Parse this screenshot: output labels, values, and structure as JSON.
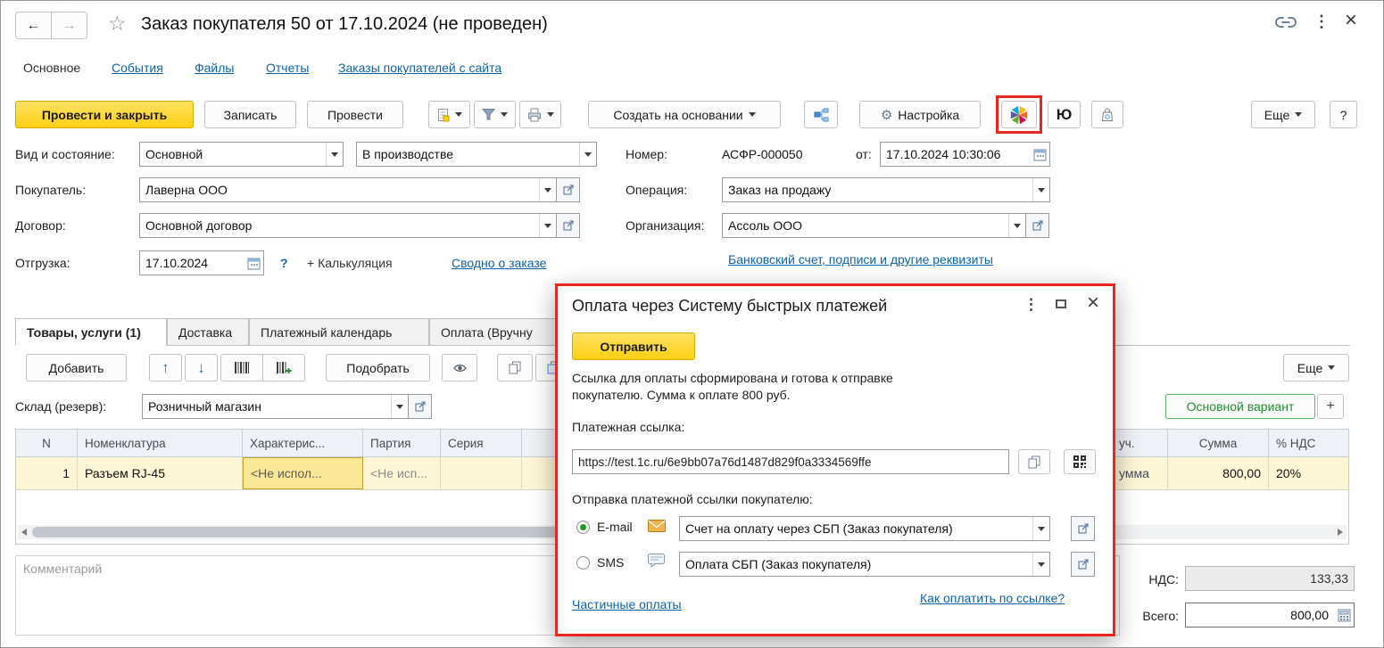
{
  "icons": {
    "back": "←",
    "forward": "→",
    "star": "☆",
    "kebab": "⋮",
    "close": "×",
    "gear": "⚙",
    "up": "↑",
    "down": "↓",
    "plus": "+"
  },
  "window": {
    "title": "Заказ покупателя 50 от 17.10.2024 (не проведен)"
  },
  "nav": {
    "main": "Основное",
    "events": "События",
    "files": "Файлы",
    "reports": "Отчеты",
    "site_orders": "Заказы покупателей с сайта"
  },
  "toolbar": {
    "post_and_close": "Провести и закрыть",
    "write": "Записать",
    "post": "Провести",
    "create_on_basis": "Создать на основании",
    "settings": "Настройка",
    "yookassa": "Ю",
    "more": "Еще",
    "help": "?"
  },
  "form": {
    "kind_state_label": "Вид и состояние:",
    "kind_value": "Основной",
    "state_value": "В производстве",
    "number_label": "Номер:",
    "number_value": "АСФР-000050",
    "from_label": "от:",
    "datetime_value": "17.10.2024 10:30:06",
    "buyer_label": "Покупатель:",
    "buyer_value": "Лаверна ООО",
    "operation_label": "Операция:",
    "operation_value": "Заказ на продажу",
    "contract_label": "Договор:",
    "contract_value": "Основной договор",
    "org_label": "Организация:",
    "org_value": "Ассоль ООО",
    "shipment_label": "Отгрузка:",
    "shipment_value": "17.10.2024",
    "shipment_help": "?",
    "calculation_label": "+ Калькуляция",
    "order_summary_link": "Сводно о заказе",
    "bank_details_link": "Банковский счет, подписи и другие реквизиты"
  },
  "doc_tabs": {
    "goods": "Товары, услуги (1)",
    "delivery": "Доставка",
    "payment_calendar": "Платежный календарь",
    "payment": "Оплата (Вручну"
  },
  "table_toolbar": {
    "add": "Добавить",
    "pick": "Подобрать",
    "more": "Еще"
  },
  "warehouse": {
    "label": "Склад (резерв):",
    "value": "Розничный магазин"
  },
  "variant": {
    "main": "Основной вариант",
    "add": "+"
  },
  "table": {
    "headers": {
      "n": "N",
      "nomenclature": "Номенклатура",
      "characteristic": "Характерис...",
      "batch": "Партия",
      "series": "Серия",
      "hidden_fragment": "уч.",
      "sum": "Сумма",
      "vat": "% НДС"
    },
    "row": {
      "n": "1",
      "nomenclature": "Разъем RJ-45",
      "characteristic": "<Не испол...",
      "batch": "<Не исп...",
      "hidden_fragment": "умма",
      "sum": "800,00",
      "vat": "20%"
    }
  },
  "comment": {
    "placeholder": "Комментарий"
  },
  "totals": {
    "vat_label": "НДС:",
    "vat_value": "133,33",
    "total_label": "Всего:",
    "total_value": "800,00"
  },
  "dialog": {
    "title": "Оплата через Систему быстрых платежей",
    "send": "Отправить",
    "info": "Ссылка для оплаты сформирована и готова к отправке покупателю. Сумма к оплате 800 руб.",
    "link_label": "Платежная ссылка:",
    "link_value": "https://test.1c.ru/6e9bb07a76d1487d829f0a3334569ffe",
    "send_method_label": "Отправка платежной ссылки покупателю:",
    "email_label": "E-mail",
    "email_template": "Счет на оплату через СБП (Заказ покупателя)",
    "sms_label": "SMS",
    "sms_template": "Оплата СБП (Заказ покупателя)",
    "partial_payments_link": "Частичные оплаты",
    "how_to_pay_link": "Как оплатить по ссылке?"
  },
  "colors": {
    "accent_yellow": "#ffd012",
    "link_blue": "#0e62ab",
    "highlight_red": "#e8281e",
    "row_selected": "#fdf6d6",
    "green_variant": "#1e8e2e"
  }
}
